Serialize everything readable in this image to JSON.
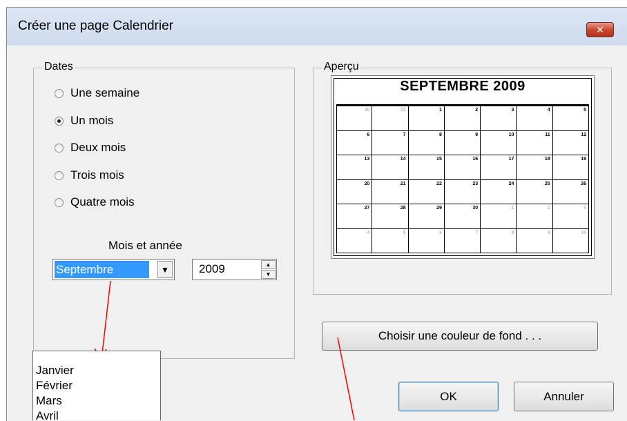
{
  "dialog": {
    "title": "Créer une page Calendrier",
    "close_label": "✕"
  },
  "dates": {
    "label": "Dates",
    "options": [
      {
        "label": "Une semaine",
        "checked": false
      },
      {
        "label": "Un mois",
        "checked": true
      },
      {
        "label": "Deux mois",
        "checked": false
      },
      {
        "label": "Trois mois",
        "checked": false
      },
      {
        "label": "Quatre mois",
        "checked": false
      }
    ],
    "month_year_label": "Mois et année",
    "month_value": "Septembre",
    "year_value": "2009"
  },
  "preview": {
    "label": "Aperçu",
    "calendar_title": "SEPTEMBRE 2009",
    "weeks": [
      [
        {
          "d": "30",
          "m": true
        },
        {
          "d": "31",
          "m": true
        },
        {
          "d": "1",
          "m": false
        },
        {
          "d": "2",
          "m": false
        },
        {
          "d": "3",
          "m": false
        },
        {
          "d": "4",
          "m": false
        },
        {
          "d": "5",
          "m": false
        }
      ],
      [
        {
          "d": "6",
          "m": false
        },
        {
          "d": "7",
          "m": false
        },
        {
          "d": "8",
          "m": false
        },
        {
          "d": "9",
          "m": false
        },
        {
          "d": "10",
          "m": false
        },
        {
          "d": "11",
          "m": false
        },
        {
          "d": "12",
          "m": false
        }
      ],
      [
        {
          "d": "13",
          "m": false
        },
        {
          "d": "14",
          "m": false
        },
        {
          "d": "15",
          "m": false
        },
        {
          "d": "16",
          "m": false
        },
        {
          "d": "17",
          "m": false
        },
        {
          "d": "18",
          "m": false
        },
        {
          "d": "19",
          "m": false
        }
      ],
      [
        {
          "d": "20",
          "m": false
        },
        {
          "d": "21",
          "m": false
        },
        {
          "d": "22",
          "m": false
        },
        {
          "d": "23",
          "m": false
        },
        {
          "d": "24",
          "m": false
        },
        {
          "d": "25",
          "m": false
        },
        {
          "d": "26",
          "m": false
        }
      ],
      [
        {
          "d": "27",
          "m": false
        },
        {
          "d": "28",
          "m": false
        },
        {
          "d": "29",
          "m": false
        },
        {
          "d": "30",
          "m": false
        },
        {
          "d": "1",
          "m": true
        },
        {
          "d": "2",
          "m": true
        },
        {
          "d": "3",
          "m": true
        }
      ],
      [
        {
          "d": "4",
          "m": true
        },
        {
          "d": "5",
          "m": true
        },
        {
          "d": "6",
          "m": true
        },
        {
          "d": "7",
          "m": true
        },
        {
          "d": "8",
          "m": true
        },
        {
          "d": "9",
          "m": true
        },
        {
          "d": "10",
          "m": true
        }
      ]
    ]
  },
  "buttons": {
    "background_color": "Choisir une couleur de fond . . .",
    "ok": "OK",
    "cancel": "Annuler"
  },
  "month_dropdown": {
    "items": [
      "Janvier",
      "Février",
      "Mars",
      "Avril"
    ]
  },
  "colors": {
    "annotation_arrow": "#ff0000",
    "selection": "#3399ff"
  }
}
